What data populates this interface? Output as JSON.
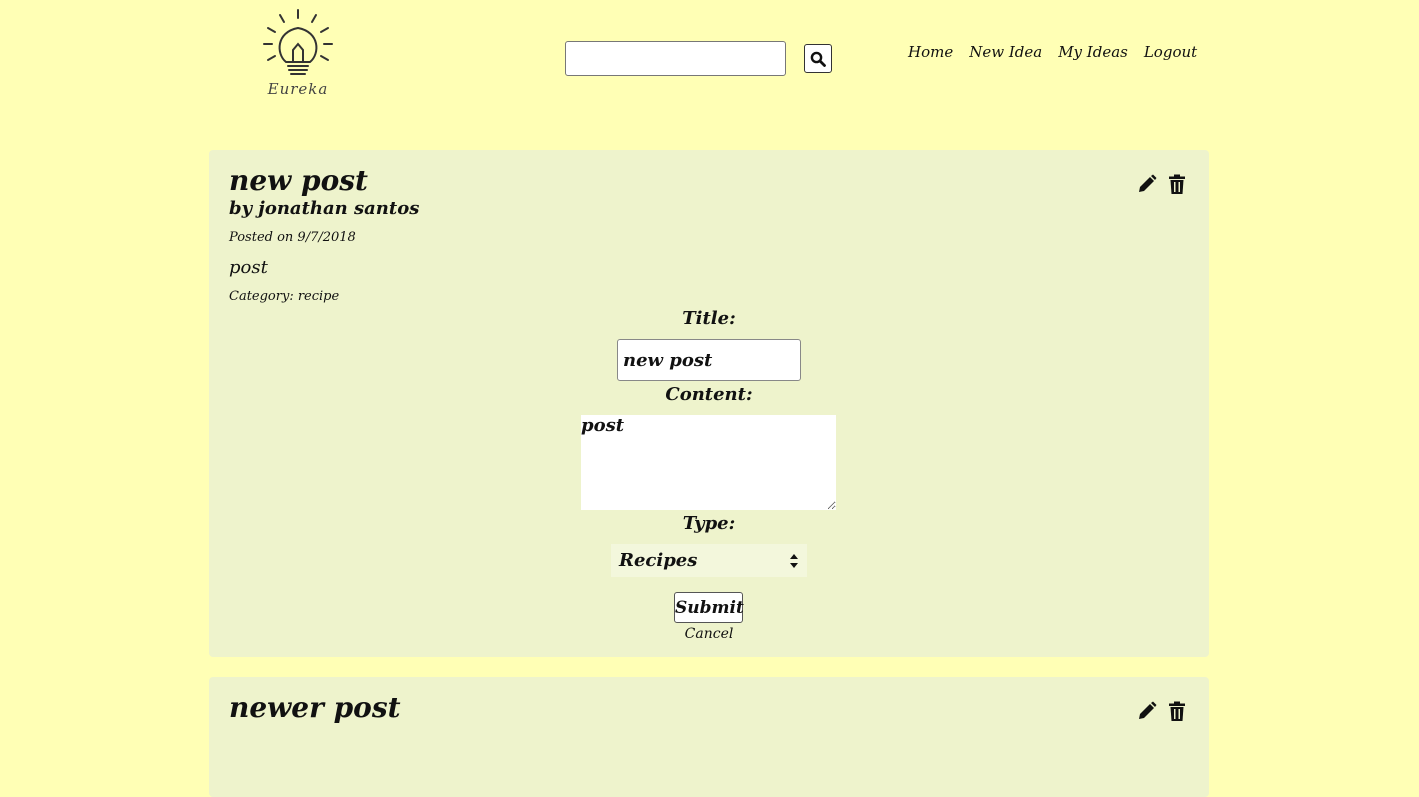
{
  "header": {
    "logo_text": "Eureka",
    "search": {
      "value": "",
      "placeholder": ""
    },
    "nav": [
      "Home",
      "New Idea",
      "My Ideas",
      "Logout"
    ]
  },
  "posts": [
    {
      "title": "new post",
      "author": "by jonathan santos",
      "date": "Posted on 9/7/2018",
      "content": "post",
      "category": "Category: recipe",
      "edit_form": {
        "title_label": "Title:",
        "title_value": "new post",
        "content_label": "Content:",
        "content_value": "post",
        "type_label": "Type:",
        "type_value": "Recipes",
        "submit_label": "Submit",
        "cancel_label": "Cancel"
      }
    },
    {
      "title": "newer post"
    }
  ],
  "icons": {
    "edit": "pencil-icon",
    "delete": "trash-icon",
    "search": "search-icon",
    "logo": "lightbulb-icon"
  }
}
